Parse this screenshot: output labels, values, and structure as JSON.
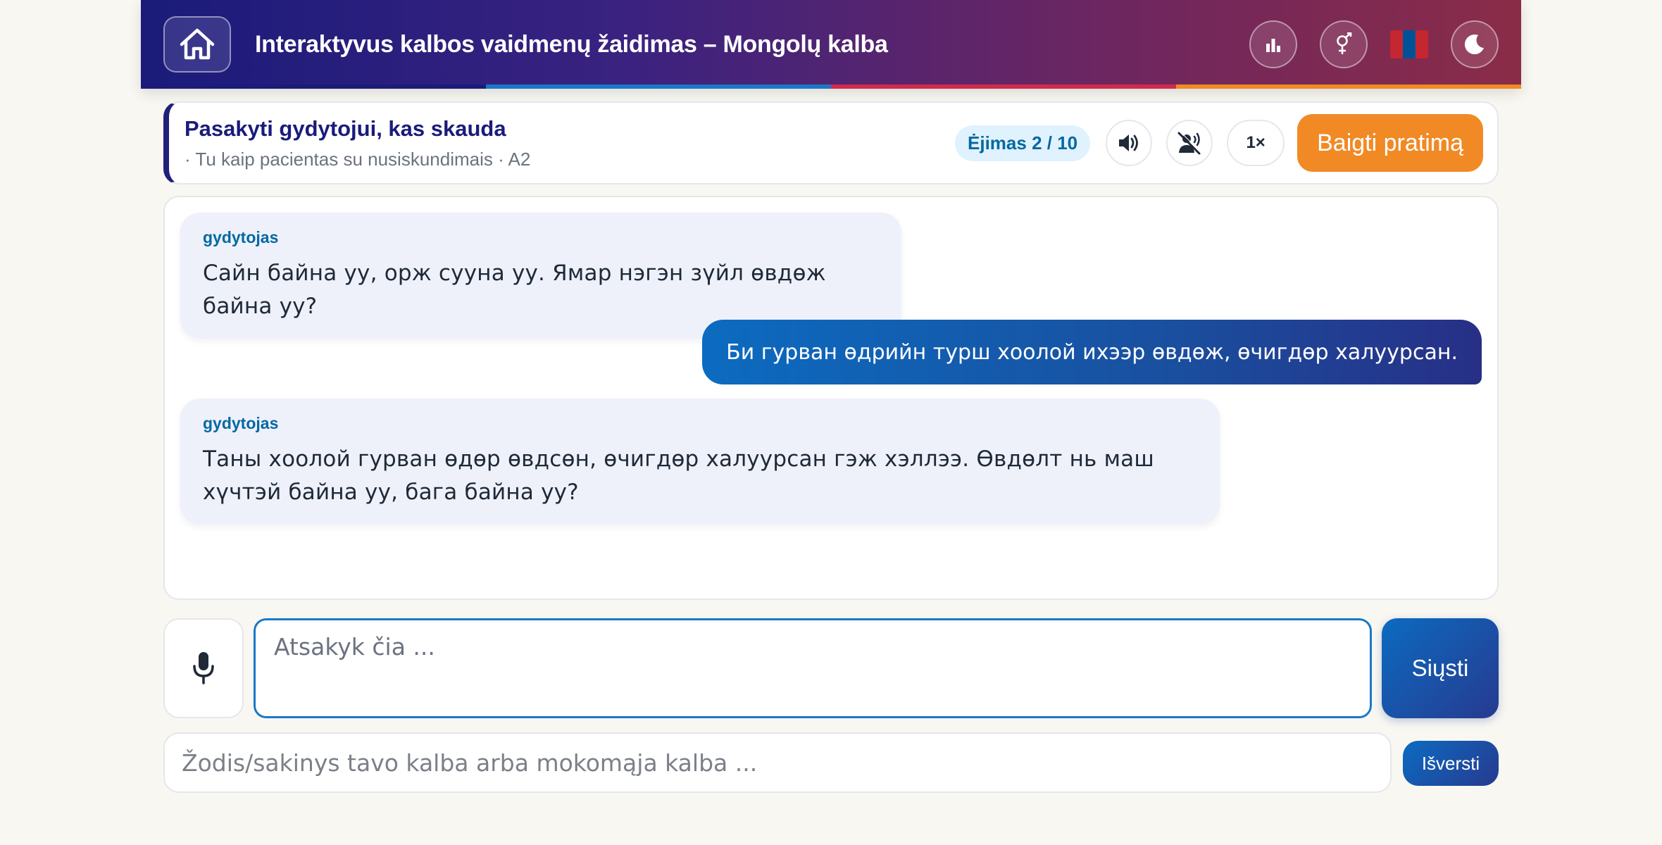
{
  "header": {
    "title": "Interaktyvus kalbos vaidmenų žaidimas – Mongolų kalba",
    "stripe_colors": [
      "#1a1b7a",
      "#1b78c8",
      "#d12b4b",
      "#f08a24"
    ],
    "icons": {
      "home": "home-icon",
      "stats": "bar-chart-icon",
      "gender": "gender-icon",
      "flag": "mongolia-flag-icon",
      "theme": "moon-icon"
    }
  },
  "task": {
    "title": "Pasakyti gydytojui, kas skauda",
    "subtitle": "· Tu kaip pacientas su nusiskundimais · A2",
    "step": "Ėjimas 2 / 10",
    "speed": "1×",
    "finish_label": "Baigti pratimą"
  },
  "chat": {
    "messages": [
      {
        "role": "bot",
        "label": "gydytojas",
        "text": "Сайн байна уу, орж сууна уу. Ямар нэгэн зүйл өвдөж байна уу?"
      },
      {
        "role": "user",
        "text": "Би гурван өдрийн турш хоолой ихээр өвдөж, өчигдөр халуурсан."
      },
      {
        "role": "bot",
        "label": "gydytojas",
        "text": "Таны хоолой гурван өдөр өвдсөн, өчигдөр халуурсан гэж хэллээ. Өвдөлт нь маш хүчтэй байна уу, бага байна уу?"
      }
    ]
  },
  "input": {
    "answer_placeholder": "Atsakyk čia ...",
    "send_label": "Siųsti",
    "translate_placeholder": "Žodis/sakinys tavo kalba arba mokomąja kalba ...",
    "translate_label": "Išversti"
  },
  "colors": {
    "accent": "#f18a24",
    "primary": "#1a1b7a",
    "link": "#0369a1"
  }
}
